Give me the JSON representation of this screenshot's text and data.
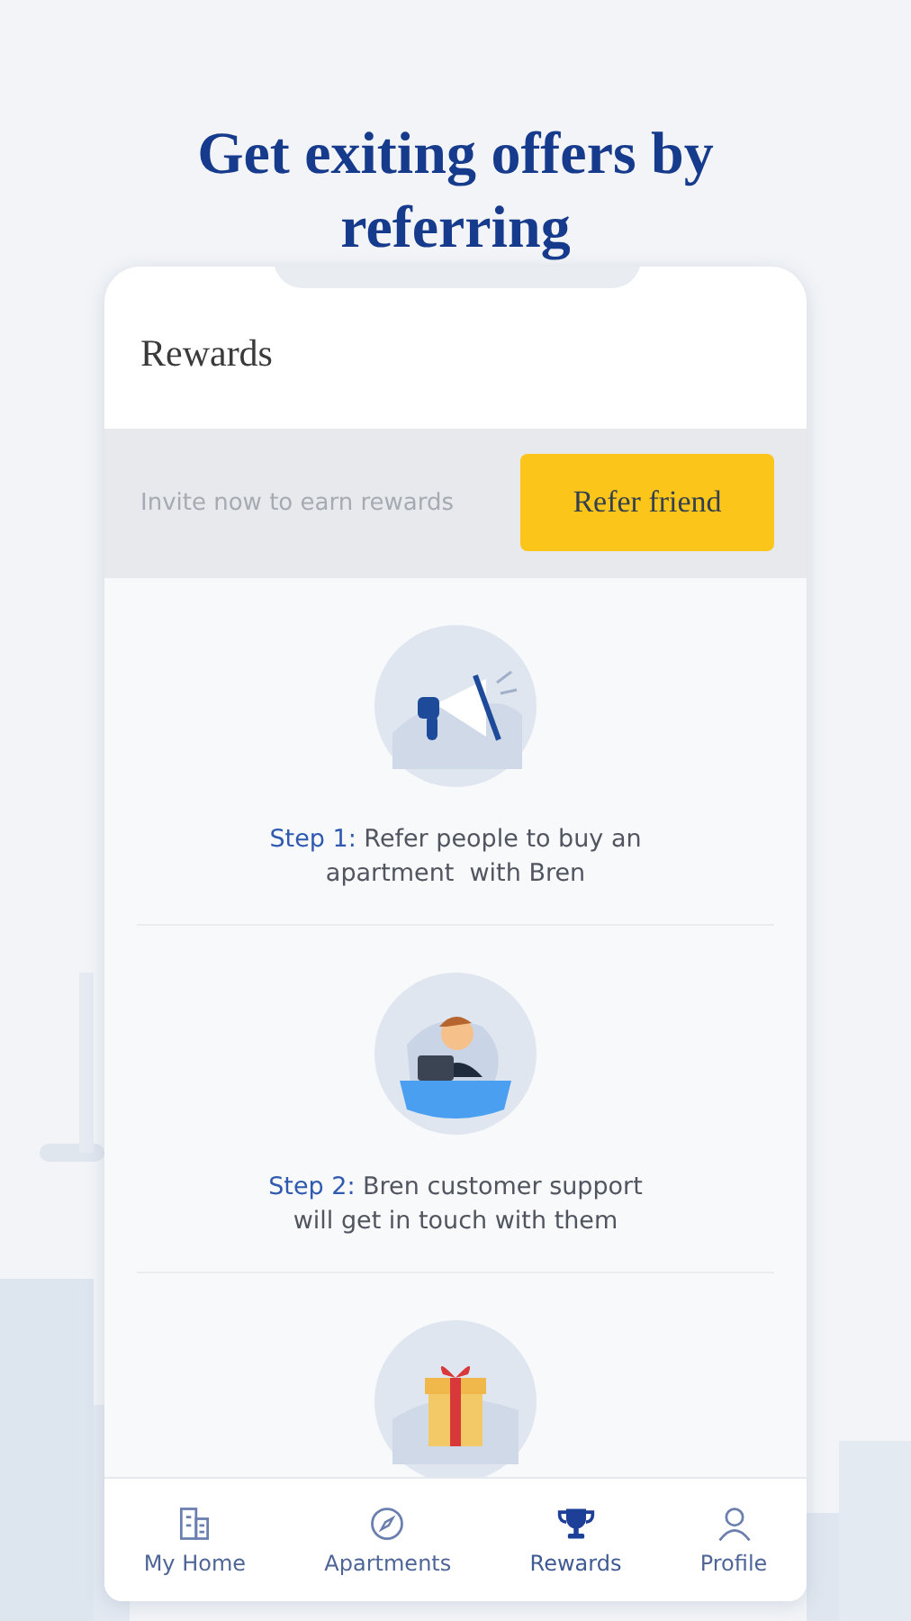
{
  "headline": "Get exiting offers by referring",
  "screen": {
    "title": "Rewards",
    "invite": {
      "text": "Invite now to earn rewards",
      "button": "Refer friend"
    },
    "steps": [
      {
        "kind": "megaphone",
        "label": "Step 1:",
        "text": "Refer people to buy an apartment  with Bren"
      },
      {
        "kind": "agent",
        "label": "Step 2:",
        "text": "Bren customer support will get in touch with them"
      },
      {
        "kind": "gift"
      }
    ],
    "nav": [
      {
        "kind": "building",
        "label": "My Home",
        "selected": false
      },
      {
        "kind": "compass",
        "label": "Apartments",
        "selected": false
      },
      {
        "kind": "trophy",
        "label": "Rewards",
        "selected": true
      },
      {
        "kind": "person",
        "label": "Profile",
        "selected": false
      }
    ]
  }
}
